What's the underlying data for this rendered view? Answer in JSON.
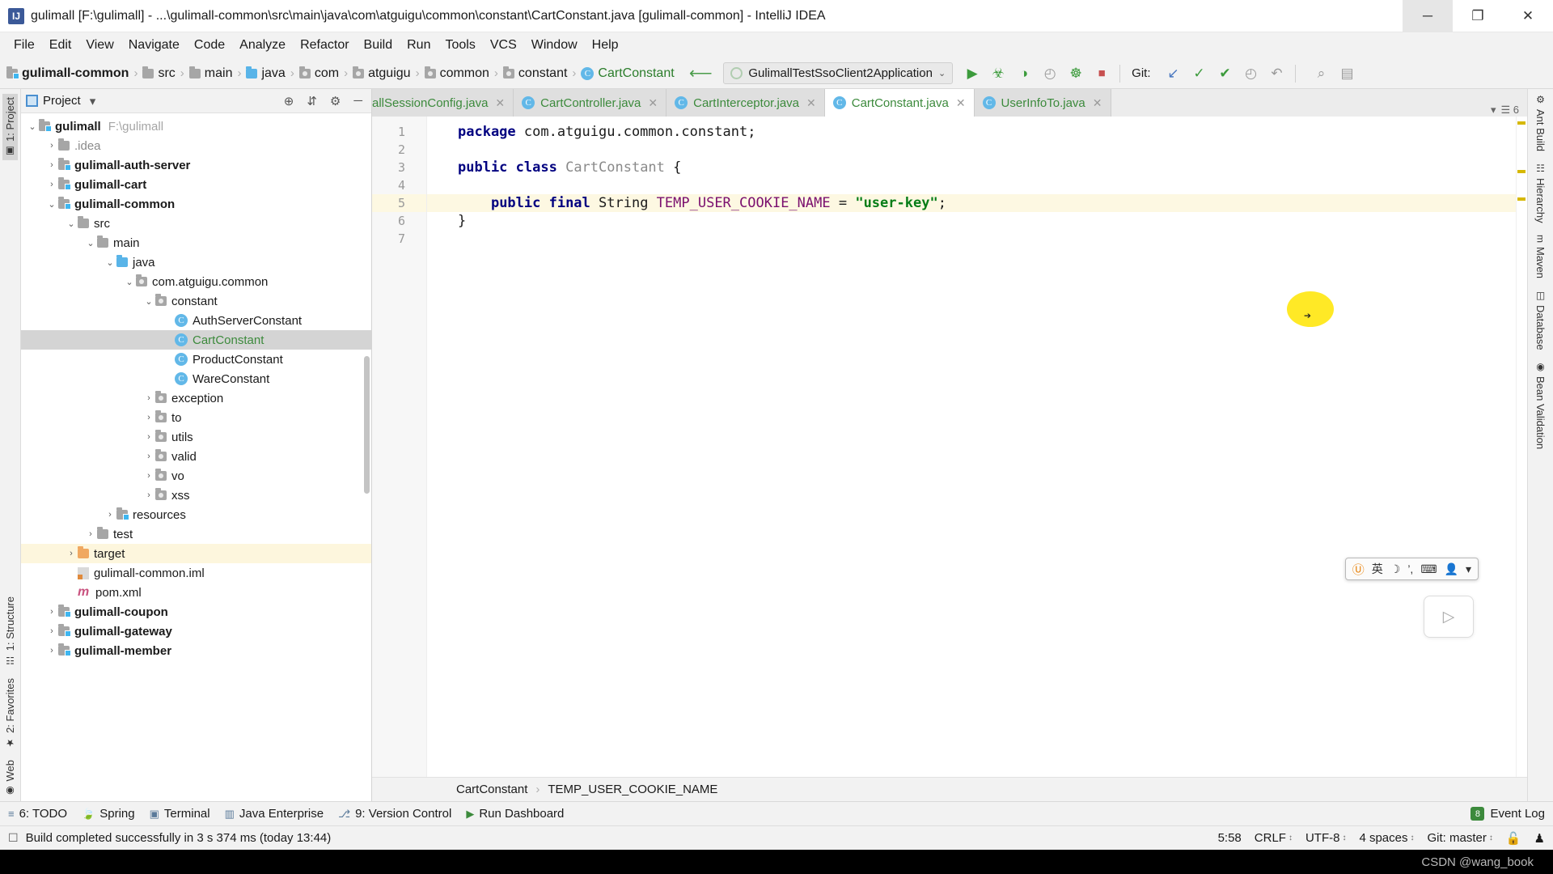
{
  "window": {
    "title": "gulimall [F:\\gulimall] - ...\\gulimall-common\\src\\main\\java\\com\\atguigu\\common\\constant\\CartConstant.java [gulimall-common] - IntelliJ IDEA",
    "app_icon": "intellij-idea-icon",
    "minimize_label": "─",
    "restore_label": "❐",
    "close_label": "✕"
  },
  "menubar": {
    "items": [
      {
        "label": "File"
      },
      {
        "label": "Edit"
      },
      {
        "label": "View"
      },
      {
        "label": "Navigate"
      },
      {
        "label": "Code"
      },
      {
        "label": "Analyze"
      },
      {
        "label": "Refactor"
      },
      {
        "label": "Build"
      },
      {
        "label": "Run"
      },
      {
        "label": "Tools"
      },
      {
        "label": "VCS"
      },
      {
        "label": "Window"
      },
      {
        "label": "Help"
      }
    ]
  },
  "navbar": {
    "crumbs": [
      {
        "label": "gulimall-common",
        "icon": "module-folder-icon",
        "kind": "module"
      },
      {
        "label": "src",
        "icon": "folder-icon",
        "kind": "folder"
      },
      {
        "label": "main",
        "icon": "folder-icon",
        "kind": "folder"
      },
      {
        "label": "java",
        "icon": "source-folder-icon",
        "kind": "source"
      },
      {
        "label": "com",
        "icon": "package-icon",
        "kind": "package"
      },
      {
        "label": "atguigu",
        "icon": "package-icon",
        "kind": "package"
      },
      {
        "label": "common",
        "icon": "package-icon",
        "kind": "package"
      },
      {
        "label": "constant",
        "icon": "package-icon",
        "kind": "package"
      },
      {
        "label": "CartConstant",
        "icon": "java-class-icon",
        "kind": "class"
      }
    ],
    "build_icon": "hammer-icon",
    "run_config": {
      "name": "GulimallTestSsoClient2Application",
      "icon": "spring-boot-icon",
      "chevron": "⌄"
    },
    "buttons": [
      {
        "name": "run-button",
        "glyph": "▶"
      },
      {
        "name": "debug-button",
        "glyph": "☣"
      },
      {
        "name": "run-with-coverage-button",
        "glyph": "◑"
      },
      {
        "name": "profiler-button",
        "glyph": "◴"
      },
      {
        "name": "attach-debugger-button",
        "glyph": "☸"
      },
      {
        "name": "stop-button",
        "glyph": "■"
      }
    ],
    "git_label": "Git:",
    "git_buttons": [
      {
        "name": "update-project-button",
        "glyph": "↙"
      },
      {
        "name": "commit-button",
        "glyph": "✓"
      },
      {
        "name": "push-button",
        "glyph": "✔"
      },
      {
        "name": "history-button",
        "glyph": "◴"
      },
      {
        "name": "rollback-button",
        "glyph": "↶"
      }
    ],
    "right_buttons": [
      {
        "name": "search-everywhere-button",
        "glyph": "⌕"
      },
      {
        "name": "settings-button",
        "glyph": "⚙"
      },
      {
        "name": "layout-button",
        "glyph": "▤"
      }
    ]
  },
  "left_rail": {
    "top": [
      {
        "label": "1: Project",
        "icon": "project-icon",
        "active": true
      }
    ],
    "bottom": [
      {
        "label": "1: Structure",
        "icon": "structure-icon"
      },
      {
        "label": "2: Favorites",
        "icon": "star-icon"
      },
      {
        "label": "Web",
        "icon": "globe-icon"
      }
    ]
  },
  "right_rail": {
    "items": [
      {
        "label": "Ant Build",
        "icon": "ant-icon"
      },
      {
        "label": "Hierarchy",
        "icon": "hierarchy-icon"
      },
      {
        "label": "Maven",
        "icon": "maven-icon"
      },
      {
        "label": "Database",
        "icon": "database-icon"
      },
      {
        "label": "Bean Validation",
        "icon": "bean-icon"
      }
    ]
  },
  "project_panel": {
    "title": "Project",
    "title_chevron": "▾",
    "header_icons": [
      {
        "name": "scroll-from-source-icon",
        "glyph": "⊕"
      },
      {
        "name": "collapse-all-icon",
        "glyph": "⇵"
      },
      {
        "name": "settings-icon",
        "glyph": "⚙"
      },
      {
        "name": "hide-icon",
        "glyph": "─"
      }
    ],
    "tree": [
      {
        "depth": 0,
        "arrow": "⌄",
        "icon": "module-folder-icon",
        "label": "gulimall",
        "bold": true,
        "path": "F:\\gulimall"
      },
      {
        "depth": 1,
        "arrow": "›",
        "icon": "folder-icon",
        "label": ".idea",
        "dim": true
      },
      {
        "depth": 1,
        "arrow": "›",
        "icon": "module-folder-icon",
        "label": "gulimall-auth-server",
        "bold": true
      },
      {
        "depth": 1,
        "arrow": "›",
        "icon": "module-folder-icon",
        "label": "gulimall-cart",
        "bold": true
      },
      {
        "depth": 1,
        "arrow": "⌄",
        "icon": "module-folder-icon",
        "label": "gulimall-common",
        "bold": true
      },
      {
        "depth": 2,
        "arrow": "⌄",
        "icon": "folder-icon",
        "label": "src"
      },
      {
        "depth": 3,
        "arrow": "⌄",
        "icon": "folder-icon",
        "label": "main"
      },
      {
        "depth": 4,
        "arrow": "⌄",
        "icon": "source-folder-icon",
        "label": "java"
      },
      {
        "depth": 5,
        "arrow": "⌄",
        "icon": "package-icon",
        "label": "com.atguigu.common"
      },
      {
        "depth": 6,
        "arrow": "⌄",
        "icon": "package-icon",
        "label": "constant"
      },
      {
        "depth": 7,
        "arrow": "",
        "icon": "java-class-icon",
        "label": "AuthServerConstant"
      },
      {
        "depth": 7,
        "arrow": "",
        "icon": "java-class-icon",
        "label": "CartConstant",
        "selected": true,
        "green": true
      },
      {
        "depth": 7,
        "arrow": "",
        "icon": "java-class-icon",
        "label": "ProductConstant"
      },
      {
        "depth": 7,
        "arrow": "",
        "icon": "java-class-icon",
        "label": "WareConstant"
      },
      {
        "depth": 6,
        "arrow": "›",
        "icon": "package-icon",
        "label": "exception"
      },
      {
        "depth": 6,
        "arrow": "›",
        "icon": "package-icon",
        "label": "to"
      },
      {
        "depth": 6,
        "arrow": "›",
        "icon": "package-icon",
        "label": "utils"
      },
      {
        "depth": 6,
        "arrow": "›",
        "icon": "package-icon",
        "label": "valid"
      },
      {
        "depth": 6,
        "arrow": "›",
        "icon": "package-icon",
        "label": "vo"
      },
      {
        "depth": 6,
        "arrow": "›",
        "icon": "package-icon",
        "label": "xss"
      },
      {
        "depth": 4,
        "arrow": "›",
        "icon": "resources-folder-icon",
        "label": "resources"
      },
      {
        "depth": 3,
        "arrow": "›",
        "icon": "folder-icon",
        "label": "test"
      },
      {
        "depth": 2,
        "arrow": "›",
        "icon": "target-folder-icon",
        "label": "target",
        "highlight": true
      },
      {
        "depth": 2,
        "arrow": "",
        "icon": "iml-file-icon",
        "label": "gulimall-common.iml"
      },
      {
        "depth": 2,
        "arrow": "",
        "icon": "maven-pom-icon",
        "label": "pom.xml"
      },
      {
        "depth": 1,
        "arrow": "›",
        "icon": "module-folder-icon",
        "label": "gulimall-coupon",
        "bold": true
      },
      {
        "depth": 1,
        "arrow": "›",
        "icon": "module-folder-icon",
        "label": "gulimall-gateway",
        "bold": true
      },
      {
        "depth": 1,
        "arrow": "›",
        "icon": "module-folder-icon",
        "label": "gulimall-member",
        "bold": true
      }
    ]
  },
  "editor": {
    "tabs": [
      {
        "label": "allSessionConfig.java",
        "icon": "java-class-icon",
        "active": false,
        "clipped": true,
        "close": "✕"
      },
      {
        "label": "CartController.java",
        "icon": "java-class-icon",
        "active": false,
        "close": "✕"
      },
      {
        "label": "CartInterceptor.java",
        "icon": "java-class-icon",
        "active": false,
        "close": "✕"
      },
      {
        "label": "CartConstant.java",
        "icon": "java-class-icon",
        "active": true,
        "close": "✕"
      },
      {
        "label": "UserInfoTo.java",
        "icon": "java-class-icon",
        "active": false,
        "close": "✕"
      }
    ],
    "tabs_right": [
      {
        "name": "tabs-list-icon",
        "glyph": "▾"
      },
      {
        "name": "tabs-count",
        "glyph": "6"
      }
    ],
    "gutter_lines": [
      "1",
      "2",
      "3",
      "4",
      "5",
      "6",
      "7"
    ],
    "intention_bulb": "💡",
    "lines": [
      {
        "n": 1,
        "tokens": [
          {
            "t": "package",
            "c": "kw"
          },
          {
            "t": " com.atguigu.common.constant;",
            "c": "pln"
          }
        ]
      },
      {
        "n": 2,
        "tokens": []
      },
      {
        "n": 3,
        "tokens": [
          {
            "t": "public class",
            "c": "kw"
          },
          {
            "t": " ",
            "c": "pln"
          },
          {
            "t": "CartConstant",
            "c": "typ"
          },
          {
            "t": " {",
            "c": "pln"
          }
        ]
      },
      {
        "n": 4,
        "tokens": []
      },
      {
        "n": 5,
        "highlight": true,
        "indent": "    ",
        "tokens": [
          {
            "t": "public final",
            "c": "kw"
          },
          {
            "t": " String ",
            "c": "pln"
          },
          {
            "t": "TEMP_USER_COOKIE_NAME",
            "c": "fld"
          },
          {
            "t": " = ",
            "c": "pln"
          },
          {
            "t": "\"user-key\"",
            "c": "str"
          },
          {
            "t": ";",
            "c": "pln"
          }
        ]
      },
      {
        "n": 6,
        "tokens": [
          {
            "t": "}",
            "c": "pln"
          }
        ]
      },
      {
        "n": 7,
        "tokens": []
      }
    ],
    "breadcrumbs": [
      {
        "label": "CartConstant"
      },
      {
        "label": "TEMP_USER_COOKIE_NAME"
      }
    ],
    "breadcrumb_sep": "›"
  },
  "ime": {
    "logo": "Ⓤ",
    "items": [
      "英",
      "☽",
      "’,",
      "⌨",
      "👤",
      "▾"
    ]
  },
  "video_bubble": {
    "icon": "play-video-icon",
    "glyph": "▷"
  },
  "toolwindow_bar": {
    "items": [
      {
        "label": "6: TODO",
        "icon": "todo-icon",
        "glyph": "≡",
        "underline": "6"
      },
      {
        "label": "Spring",
        "icon": "spring-icon",
        "glyph": "🍃"
      },
      {
        "label": "Terminal",
        "icon": "terminal-icon",
        "glyph": "▣"
      },
      {
        "label": "Java Enterprise",
        "icon": "java-enterprise-icon",
        "glyph": "▥"
      },
      {
        "label": "9: Version Control",
        "icon": "version-control-icon",
        "glyph": "⎇",
        "underline": "9"
      },
      {
        "label": "Run Dashboard",
        "icon": "run-dashboard-icon",
        "glyph": "▶"
      }
    ],
    "event_log": {
      "label": "Event Log",
      "badge": "8"
    }
  },
  "statusbar": {
    "icon": "build-status-icon",
    "message": "Build completed successfully in 3 s 374 ms (today 13:44)",
    "right": [
      {
        "name": "caret-position",
        "label": "5:58",
        "chevron": ""
      },
      {
        "name": "line-separator",
        "label": "CRLF",
        "chevron": "↕"
      },
      {
        "name": "file-encoding",
        "label": "UTF-8",
        "chevron": "↕"
      },
      {
        "name": "indent-setting",
        "label": "4 spaces",
        "chevron": "↕"
      },
      {
        "name": "git-branch",
        "label": "Git: master",
        "chevron": "↕"
      },
      {
        "name": "lock-icon",
        "label": "🔓",
        "chevron": ""
      },
      {
        "name": "memory-indicator",
        "label": "♟",
        "chevron": ""
      }
    ]
  },
  "watermark": {
    "text": "CSDN @wang_book"
  },
  "colors": {
    "accent_green": "#3c8a3c",
    "keyword_blue": "#000080",
    "string_green": "#067d17",
    "field_purple": "#7a0f6e",
    "highlight_yellow": "#fdf8e2",
    "cursor_glow": "#ffe500",
    "selection_gray": "#d4d4d4"
  }
}
